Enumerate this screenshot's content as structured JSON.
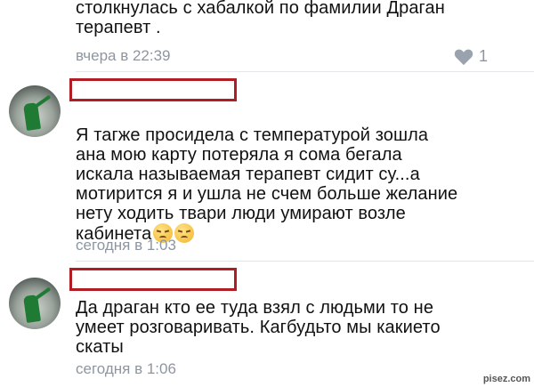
{
  "comment1": {
    "text": "столкнулась с хабалкой по фамилии Драган\nтерапевт .",
    "time": "вчера в 22:39",
    "likes": "1"
  },
  "comment2": {
    "text": "Я тагже просидела с температурой зошла\nана мою карту потеряла я сома бегала\nискала называемая терапевт сидит су...а\nмотирится я и ушла не счем больше желание\nнету ходить твари люди умирают возле\nкабинета",
    "emojis": [
      "pensive-face",
      "pensive-face"
    ],
    "time": "сегодня в 1:03"
  },
  "comment3": {
    "text": "Да драган кто ее туда взял с людьми то не\nумеет розговаривать. Кагбудьто мы какието\nскаты",
    "time": "сегодня в 1:06"
  },
  "watermark": "pisez.com",
  "colors": {
    "timestamp": "#8d96a0",
    "redaction_border": "#b01d24",
    "avatar_figure": "#1f7a33"
  }
}
